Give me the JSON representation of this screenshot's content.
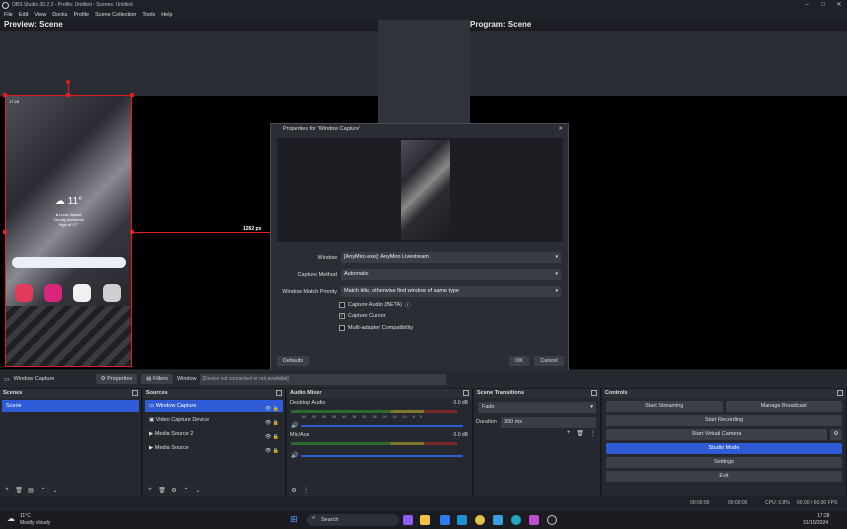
{
  "app": {
    "title": "OBS Studio 30.2.3 - Profile: Untitled - Scenes: Untitled"
  },
  "menu": [
    "File",
    "Edit",
    "View",
    "Docks",
    "Profile",
    "Scene Collection",
    "Tools",
    "Help"
  ],
  "preview": {
    "label": "Preview: Scene"
  },
  "program": {
    "label": "Program: Scene"
  },
  "phone": {
    "time": "17:28",
    "temp": "11°",
    "location": "● Luna Varlust",
    "forecast": "Cloudy tomorrow",
    "high": "High of 17°"
  },
  "dimension": "1262 px",
  "dialog": {
    "title": "Properties for 'Window Capture'",
    "window_label": "Window",
    "window_value": "[AnyMiro.exe]: AnyMiro Livestream",
    "method_label": "Capture Method",
    "method_value": "Automatic",
    "priority_label": "Window Match Priority",
    "priority_value": "Match title, otherwise find window of same type",
    "audio_label": "Capture Audio (BETA)",
    "cursor_label": "Capture Cursor",
    "compat_label": "Multi-adapter Compatibility",
    "defaults": "Defaults",
    "ok": "OK",
    "cancel": "Cancel"
  },
  "sourcebar": {
    "name": "Window Capture",
    "properties": "Properties",
    "filters": "Filters",
    "window_label": "Window",
    "window_value": "[Device not connected or not available]"
  },
  "scenes": {
    "title": "Scenes",
    "items": [
      "Scene"
    ]
  },
  "sources": {
    "title": "Sources",
    "items": [
      "Window Capture",
      "Video Capture Device",
      "Media Source 2",
      "Media Source"
    ]
  },
  "mixer": {
    "title": "Audio Mixer",
    "ch1": "Desktop Audio",
    "ch1db": "0.0 dB",
    "ch2": "Mic/Aux",
    "ch2db": "0.0 dB",
    "ticks": [
      "-60",
      "-55",
      "-50",
      "-45",
      "-40",
      "-35",
      "-30",
      "-25",
      "-20",
      "-15",
      "-10",
      "-5",
      "0"
    ]
  },
  "transitions": {
    "title": "Scene Transitions",
    "type": "Fade",
    "duration_label": "Duration",
    "duration": "300 ms"
  },
  "controls": {
    "title": "Controls",
    "start_streaming": "Start Streaming",
    "manage_broadcast": "Manage Broadcast",
    "start_recording": "Start Recording",
    "virtual_camera": "Start Virtual Camera",
    "studio_mode": "Studio Mode",
    "settings": "Settings",
    "exit": "Exit"
  },
  "status": {
    "rec1": "00:00:00",
    "rec2": "00:00:00",
    "cpu": "CPU: 0.8%",
    "fps": "60.00 / 60.00 FPS"
  },
  "taskbar": {
    "temp": "11°C",
    "weather": "Mostly cloudy",
    "search": "Search",
    "time": "17:28",
    "date": "31/10/2024"
  }
}
